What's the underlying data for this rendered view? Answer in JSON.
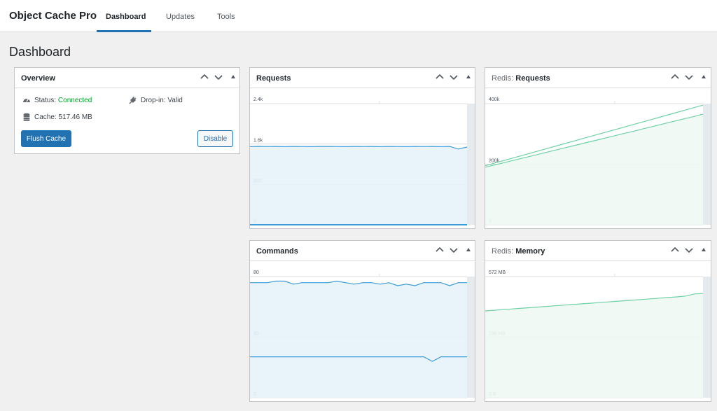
{
  "app": {
    "title": "Object Cache Pro"
  },
  "tabs": [
    {
      "label": "Dashboard",
      "active": true
    },
    {
      "label": "Updates",
      "active": false
    },
    {
      "label": "Tools",
      "active": false
    }
  ],
  "page": {
    "title": "Dashboard"
  },
  "overview": {
    "title": "Overview",
    "status_label": "Status:",
    "status_value": "Connected",
    "dropin_label": "Drop-in:",
    "dropin_value": "Valid",
    "cache_label": "Cache:",
    "cache_value": "517.46 MB",
    "flush_label": "Flush Cache",
    "disable_label": "Disable"
  },
  "panels": {
    "requests": {
      "title": "Requests"
    },
    "redis_requests": {
      "prefix": "Redis:",
      "title": "Requests"
    },
    "commands": {
      "title": "Commands"
    },
    "redis_memory": {
      "prefix": "Redis:",
      "title": "Memory"
    }
  },
  "colors": {
    "accent": "#2271b1",
    "connected": "#00a32a",
    "blue_line": "#3b9bd6",
    "blue_fill": "#e5f2fa",
    "green_line": "#6ed1a4",
    "green_fill": "#eef8f3"
  },
  "icons": [
    "dashboard-icon",
    "plug-icon",
    "database-icon",
    "chevron-up-icon",
    "chevron-down-icon",
    "triangle-up-icon"
  ],
  "chart_data": [
    {
      "type": "area",
      "title": "Requests",
      "ylim": [
        0,
        2400
      ],
      "ytick_labels": [
        "2.4k",
        "1.6k",
        "800",
        "0"
      ],
      "ytick_values": [
        2400,
        1600,
        800,
        0
      ],
      "series": [
        {
          "values": [
            1550,
            1552,
            1551,
            1553,
            1550,
            1552,
            1551,
            1550,
            1552,
            1553,
            1551,
            1550,
            1552,
            1551,
            1553,
            1550,
            1552,
            1551,
            1550,
            1552,
            1551,
            1553,
            1550,
            1552,
            1500,
            1540
          ]
        },
        {
          "values": [
            0,
            0,
            0,
            0,
            0,
            0,
            0,
            0,
            0,
            0,
            0,
            0,
            0,
            0,
            0,
            0,
            0,
            0,
            0,
            0,
            0,
            0,
            0,
            0,
            0,
            0
          ]
        }
      ]
    },
    {
      "type": "area",
      "title": "Requests",
      "ylim": [
        0,
        400000
      ],
      "ytick_labels": [
        "400k",
        "200k",
        "0"
      ],
      "ytick_values": [
        400000,
        200000,
        0
      ],
      "series": [
        {
          "values": [
            190000,
            197000,
            204000,
            211000,
            218000,
            225000,
            232000,
            239000,
            246000,
            253000,
            260000,
            267000,
            274000,
            281000,
            288000,
            295000,
            302000,
            309000,
            316000,
            323000,
            330000,
            337000,
            344000,
            351000,
            358000,
            365000
          ]
        },
        {
          "values": [
            195000,
            203000,
            211000,
            219000,
            227000,
            235000,
            243000,
            251000,
            259000,
            267000,
            275000,
            283000,
            291000,
            299000,
            307000,
            315000,
            323000,
            331000,
            339000,
            347000,
            355000,
            363000,
            371000,
            379000,
            387000,
            395000
          ]
        }
      ]
    },
    {
      "type": "area",
      "title": "Commands",
      "ylim": [
        0,
        80
      ],
      "ytick_labels": [
        "80",
        "40",
        "0"
      ],
      "ytick_values": [
        80,
        40,
        0
      ],
      "series": [
        {
          "values": [
            76,
            76,
            76,
            77,
            77,
            75,
            76,
            76,
            76,
            76,
            77,
            76,
            75,
            76,
            76,
            75,
            76,
            74,
            75,
            74,
            76,
            76,
            76,
            74,
            76,
            76
          ]
        },
        {
          "values": [
            27,
            27,
            27,
            27,
            27,
            27,
            27,
            27,
            27,
            27,
            27,
            27,
            27,
            27,
            27,
            27,
            27,
            27,
            27,
            27,
            27,
            24,
            27,
            27,
            27,
            27
          ]
        }
      ]
    },
    {
      "type": "area",
      "title": "Memory",
      "ylim": [
        0,
        572
      ],
      "ytick_labels": [
        "572 MB",
        "286 MB",
        "0 B"
      ],
      "ytick_values": [
        572,
        286,
        0
      ],
      "series": [
        {
          "values": [
            410,
            413,
            416,
            419,
            422,
            425,
            428,
            431,
            434,
            437,
            440,
            443,
            446,
            449,
            452,
            455,
            458,
            461,
            464,
            467,
            470,
            473,
            476,
            480,
            490,
            492
          ]
        }
      ]
    }
  ]
}
